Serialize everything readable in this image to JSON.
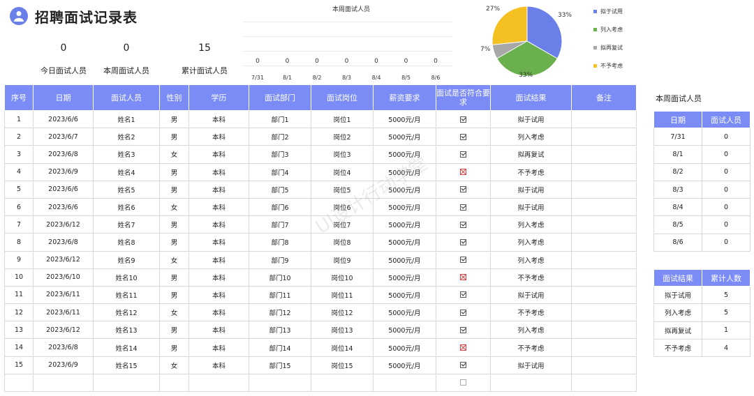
{
  "header": {
    "title": "招聘面试记录表"
  },
  "kpis": [
    {
      "value": "0",
      "label": "今日面试人员"
    },
    {
      "value": "0",
      "label": "本周面试人员"
    },
    {
      "value": "15",
      "label": "累计面试人员"
    }
  ],
  "weekly_chart": {
    "title": "本周面试人员",
    "categories": [
      "7/31",
      "8/1",
      "8/2",
      "8/3",
      "8/4",
      "8/5",
      "8/6"
    ],
    "values": [
      "0",
      "0",
      "0",
      "0",
      "0",
      "0",
      "0"
    ]
  },
  "pie": {
    "labels": [
      "33%",
      "33%",
      "7%",
      "27%"
    ],
    "colors": [
      "#6b7fe8",
      "#6ab04c",
      "#a8a8a8",
      "#f5c021"
    ],
    "legend": [
      "拟于试用",
      "列入考虑",
      "拟再复试",
      "不予考虑"
    ]
  },
  "table": {
    "headers": [
      "序号",
      "日期",
      "面试人员",
      "性别",
      "学历",
      "面试部门",
      "面试岗位",
      "薪资要求",
      "面试是否符合要求",
      "面试结果",
      "备注"
    ],
    "rows": [
      [
        "1",
        "2023/6/6",
        "姓名1",
        "男",
        "本科",
        "部门1",
        "岗位1",
        "5000元/月",
        "yes",
        "拟于试用",
        ""
      ],
      [
        "2",
        "2023/6/7",
        "姓名2",
        "男",
        "本科",
        "部门2",
        "岗位2",
        "5000元/月",
        "yes",
        "列入考虑",
        ""
      ],
      [
        "3",
        "2023/6/8",
        "姓名3",
        "女",
        "本科",
        "部门3",
        "岗位3",
        "5000元/月",
        "yes",
        "拟再复试",
        ""
      ],
      [
        "4",
        "2023/6/9",
        "姓名4",
        "男",
        "本科",
        "部门4",
        "岗位4",
        "5000元/月",
        "no",
        "不予考虑",
        ""
      ],
      [
        "5",
        "2023/6/6",
        "姓名5",
        "男",
        "本科",
        "部门5",
        "岗位5",
        "5000元/月",
        "yes",
        "拟于试用",
        ""
      ],
      [
        "6",
        "2023/6/6",
        "姓名6",
        "女",
        "本科",
        "部门6",
        "岗位6",
        "5000元/月",
        "yes",
        "拟于试用",
        ""
      ],
      [
        "7",
        "2023/6/12",
        "姓名7",
        "男",
        "本科",
        "部门7",
        "岗位7",
        "5000元/月",
        "yes",
        "列入考虑",
        ""
      ],
      [
        "8",
        "2023/6/8",
        "姓名8",
        "男",
        "本科",
        "部门8",
        "岗位8",
        "5000元/月",
        "yes",
        "列入考虑",
        ""
      ],
      [
        "9",
        "2023/6/12",
        "姓名9",
        "女",
        "本科",
        "部门9",
        "岗位9",
        "5000元/月",
        "yes",
        "列入考虑",
        ""
      ],
      [
        "10",
        "2023/6/10",
        "姓名10",
        "男",
        "本科",
        "部门10",
        "岗位10",
        "5000元/月",
        "no",
        "不予考虑",
        ""
      ],
      [
        "11",
        "2023/6/11",
        "姓名11",
        "男",
        "本科",
        "部门11",
        "岗位11",
        "5000元/月",
        "yes",
        "拟于试用",
        ""
      ],
      [
        "12",
        "2023/6/11",
        "姓名12",
        "女",
        "本科",
        "部门12",
        "岗位12",
        "5000元/月",
        "yes",
        "不予考虑",
        ""
      ],
      [
        "13",
        "2023/6/12",
        "姓名13",
        "男",
        "本科",
        "部门13",
        "岗位13",
        "5000元/月",
        "yes",
        "列入考虑",
        ""
      ],
      [
        "14",
        "2023/6/8",
        "姓名14",
        "男",
        "本科",
        "部门14",
        "岗位14",
        "5000元/月",
        "no",
        "不予考虑",
        ""
      ],
      [
        "15",
        "2023/6/9",
        "姓名15",
        "女",
        "本科",
        "部门15",
        "岗位15",
        "5000元/月",
        "yes",
        "拟于试用",
        ""
      ],
      [
        "",
        "",
        "",
        "",
        "",
        "",
        "",
        "",
        "empty",
        "",
        ""
      ]
    ]
  },
  "side_weekly": {
    "title": "本周面试人员",
    "headers": [
      "日期",
      "面试人员"
    ],
    "rows": [
      [
        "7/31",
        "0"
      ],
      [
        "8/1",
        "0"
      ],
      [
        "8/2",
        "0"
      ],
      [
        "8/3",
        "0"
      ],
      [
        "8/4",
        "0"
      ],
      [
        "8/5",
        "0"
      ],
      [
        "8/6",
        "0"
      ]
    ]
  },
  "side_results": {
    "headers": [
      "面试结果",
      "累计人数"
    ],
    "rows": [
      [
        "拟于试用",
        "5"
      ],
      [
        "列入考虑",
        "5"
      ],
      [
        "拟再复试",
        "1"
      ],
      [
        "不予考虑",
        "4"
      ]
    ]
  },
  "watermark": "UI设计行动学堂"
}
